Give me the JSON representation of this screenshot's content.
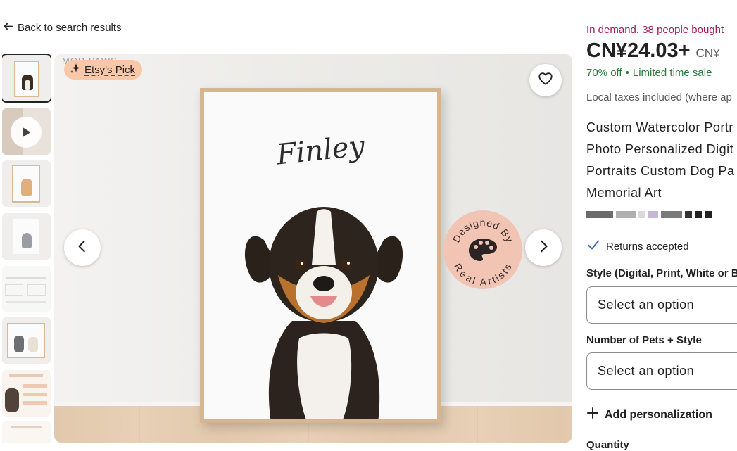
{
  "nav": {
    "back_label": "Back to search results"
  },
  "gallery": {
    "badge_label": "Etsy's Pick",
    "background_text": "MOD PAWS",
    "pet_name": "Finley",
    "stamp_top": "Designed By",
    "stamp_bottom": "Real Artists"
  },
  "listing": {
    "demand_text": "In demand. 38 people bought",
    "price": "CN¥24.03+",
    "original_price": "CN¥",
    "discount": "70% off",
    "dot": "•",
    "sale_text": "Limited time sale",
    "taxes": "Local taxes included (where ap",
    "title": "Custom Watercolor Portr Photo Personalized Digit Portraits Custom Dog Pa Memorial Art",
    "returns": "Returns accepted",
    "style_label": "Style (Digital, Print, White or B",
    "style_select": "Select an option",
    "pets_label": "Number of Pets + Style",
    "pets_select": "Select an option",
    "add_personalization": "Add personalization",
    "quantity_label": "Quantity"
  },
  "colors": {
    "demand": "#a61a5a",
    "sale": "#2b7a3b",
    "badge": "#f8c8a8",
    "frame": "#d6b692"
  },
  "icons": [
    "arrow-left-icon",
    "sparkle-icon",
    "heart-icon",
    "chevron-left-icon",
    "chevron-right-icon",
    "play-icon",
    "check-icon",
    "plus-icon",
    "palette-icon"
  ]
}
